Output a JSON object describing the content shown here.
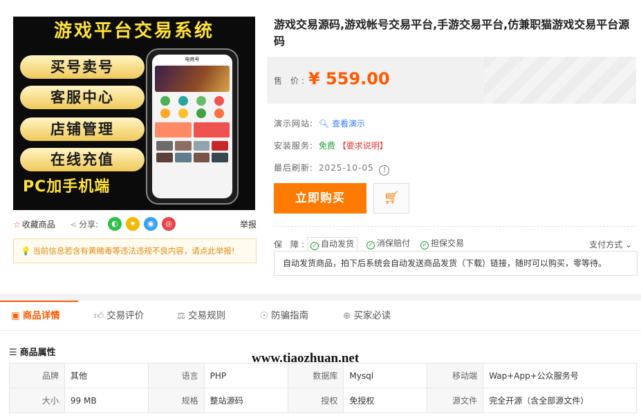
{
  "image": {
    "banner": "游戏平台交易系统",
    "pills": [
      "买号卖号",
      "客服中心",
      "店铺管理",
      "在线充值"
    ],
    "bottom": "PC加手机端",
    "phone_title": "电商号"
  },
  "img_actions": {
    "favorite": "收藏商品",
    "share": "分享:",
    "share_icons": [
      "wechat-icon",
      "qzone-icon",
      "qq-icon",
      "weibo-icon"
    ],
    "report": "举报"
  },
  "warning": "当前信息若含有黄赌毒等违法违规不良内容，请点此举报!",
  "product": {
    "title": "游戏交易源码,游戏帐号交易平台,手游交易平台,仿兼职猫游戏交易平台源码",
    "price_label": "售 价:",
    "price": "¥ 559.00",
    "demo_label": "演示网站:",
    "demo_link": "查看演示",
    "install_label": "安装服务:",
    "install_value": "免费",
    "install_note": "【要求说明】",
    "refresh_label": "最后刷新:",
    "refresh_value": "2025-10-05",
    "buy_button": "立即购买"
  },
  "guarantee": {
    "label": "保 障:",
    "items": [
      "自动发货",
      "消保赔付",
      "担保交易"
    ],
    "payment": "支付方式",
    "description": "自动发货商品，拍下后系统会自动发送商品发货（下载）链接，随时可以购买，零等待。"
  },
  "tabs": [
    "商品详情",
    "交易评价",
    "交易规则",
    "防骗指南",
    "买家必读"
  ],
  "attributes": {
    "title": "商品属性",
    "rows": [
      [
        [
          "品牌",
          "其他"
        ],
        [
          "语言",
          "PHP"
        ],
        [
          "数据库",
          "Mysql"
        ],
        [
          "移动端",
          "Wap+App+公众服务号"
        ]
      ],
      [
        [
          "大小",
          "99 MB"
        ],
        [
          "规格",
          "整站源码"
        ],
        [
          "授权",
          "免授权"
        ],
        [
          "源文件",
          "完全开源（含全部源文件）"
        ]
      ]
    ]
  },
  "watermark": "www.tiaozhuan.net",
  "colors": {
    "accent": "#ff5a00",
    "buy": "#ff7a00",
    "green": "#22a03a",
    "link": "#3b82f6"
  }
}
